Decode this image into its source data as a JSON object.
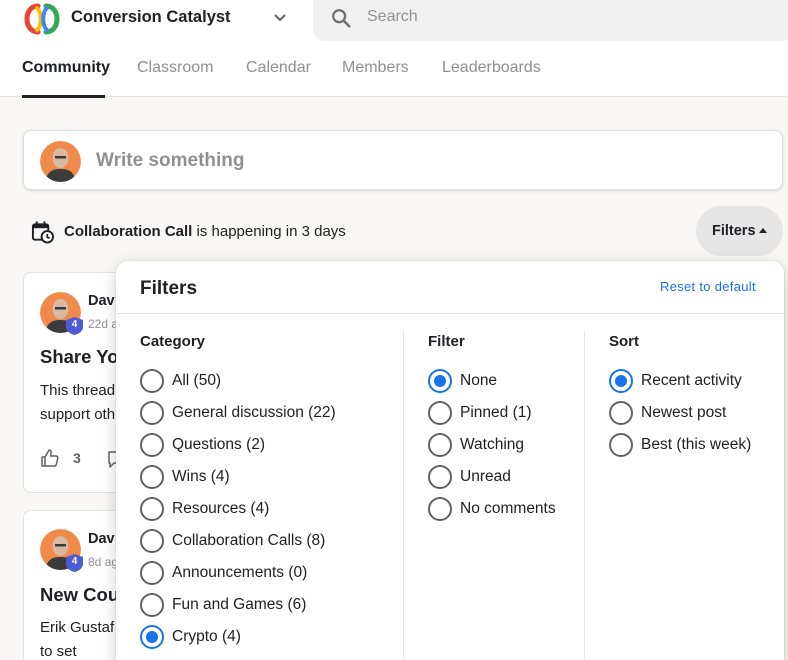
{
  "header": {
    "app_name": "Conversion Catalyst",
    "search_placeholder": "Search",
    "tabs": [
      {
        "label": "Community",
        "active": true
      },
      {
        "label": "Classroom",
        "active": false
      },
      {
        "label": "Calendar",
        "active": false
      },
      {
        "label": "Members",
        "active": false
      },
      {
        "label": "Leaderboards",
        "active": false
      }
    ]
  },
  "composer": {
    "placeholder": "Write something"
  },
  "event": {
    "name": "Collaboration Call",
    "suffix": " is happening in 3 days"
  },
  "filters_button": {
    "label": "Filters"
  },
  "posts": [
    {
      "author": "Dav",
      "time": "22d a",
      "level": "4",
      "title": "Share Yo",
      "body": "This thread support oth",
      "likes": "3"
    },
    {
      "author": "Dav",
      "time": "8d ag",
      "level": "4",
      "title": "New Cou",
      "body": "Erik Gustaf how to set"
    }
  ],
  "filters_panel": {
    "title": "Filters",
    "reset_label": "Reset to default",
    "category": {
      "heading": "Category",
      "options": [
        {
          "label": "All (50)",
          "checked": false
        },
        {
          "label": "General discussion (22)",
          "checked": false
        },
        {
          "label": "Questions (2)",
          "checked": false
        },
        {
          "label": "Wins (4)",
          "checked": false
        },
        {
          "label": "Resources (4)",
          "checked": false
        },
        {
          "label": "Collaboration Calls (8)",
          "checked": false
        },
        {
          "label": "Announcements (0)",
          "checked": false
        },
        {
          "label": "Fun and Games (6)",
          "checked": false
        },
        {
          "label": "Crypto (4)",
          "checked": true
        }
      ]
    },
    "filter": {
      "heading": "Filter",
      "options": [
        {
          "label": "None",
          "checked": true
        },
        {
          "label": "Pinned (1)",
          "checked": false
        },
        {
          "label": "Watching",
          "checked": false
        },
        {
          "label": "Unread",
          "checked": false
        },
        {
          "label": "No comments",
          "checked": false
        }
      ]
    },
    "sort": {
      "heading": "Sort",
      "options": [
        {
          "label": "Recent activity",
          "checked": true
        },
        {
          "label": "Newest post",
          "checked": false
        },
        {
          "label": "Best (this week)",
          "checked": false
        }
      ]
    }
  },
  "colors": {
    "accent": "#1a73e8",
    "level_badge": "#4f5bd5"
  }
}
